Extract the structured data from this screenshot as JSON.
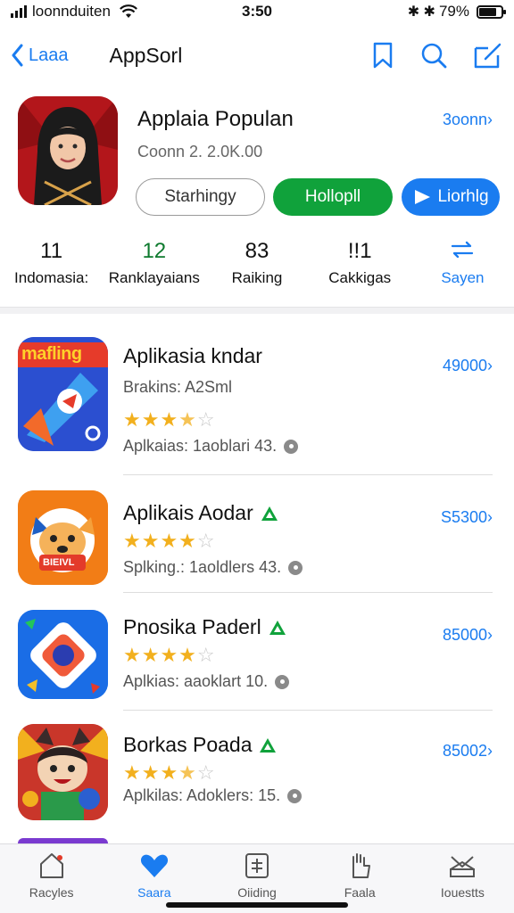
{
  "status_bar": {
    "carrier": "loonnduiten",
    "time": "3:50",
    "bluetooth": "✱ ✱",
    "battery_text": "79%",
    "battery_level": 0.79
  },
  "nav": {
    "back_label": "Laaa",
    "title": "AppSorl",
    "icons": [
      "bookmark-icon",
      "search-icon",
      "compose-icon"
    ]
  },
  "featured": {
    "title": "Applaia Populan",
    "subtitle": "Coonn 2. 2.0K.00",
    "link": "3oonn",
    "buttons": {
      "outline": "Starhingy",
      "green": "Hollopll",
      "blue": "Liorhlg"
    }
  },
  "stats": [
    {
      "value": "11",
      "label": "Indomasia:"
    },
    {
      "value": "12",
      "label": "Ranklayaians"
    },
    {
      "value": "83",
      "label": "Raiking"
    },
    {
      "value": "!!1",
      "label": "Cakkigas"
    },
    {
      "value": "",
      "label": "Sayen"
    }
  ],
  "apps": [
    {
      "name": "Aplikasia kndar",
      "sub": "Brakins: A2Sml",
      "rating": 3.5,
      "stars": "★★★½☆",
      "desc": "Aplkaias: 1aoblari 43.",
      "price": "49000",
      "icon_text": "mafling",
      "badge": false
    },
    {
      "name": "Aplikais Aodar",
      "sub": "",
      "rating": 4,
      "stars": "★★★★☆",
      "desc": "Splking.: 1aoldlers 43.",
      "price": "S5300",
      "icon_text": "BIEIVL",
      "badge": true
    },
    {
      "name": "Pnosika Paderl",
      "sub": "",
      "rating": 4,
      "stars": "★★★★☆",
      "desc": "Aplkias: aaoklart 10.",
      "price": "85000",
      "icon_text": "",
      "badge": true
    },
    {
      "name": "Borkas Poada",
      "sub": "",
      "rating": 3.5,
      "stars": "★★★½☆",
      "desc": "Aplkilas: Adoklers: 15.",
      "price": "85002",
      "icon_text": "",
      "badge": true
    }
  ],
  "tabs": [
    {
      "label": "Racyles",
      "icon": "home-icon"
    },
    {
      "label": "Saara",
      "icon": "heart-icon",
      "active": true
    },
    {
      "label": "Oiiding",
      "icon": "calculator-icon"
    },
    {
      "label": "Faala",
      "icon": "hand-icon"
    },
    {
      "label": "Iouestts",
      "icon": "inbox-icon"
    }
  ],
  "colors": {
    "accent": "#1a7cf0",
    "green": "#10a23b",
    "star": "#f2b01e",
    "featured_icon_bg": "#b3161b"
  }
}
